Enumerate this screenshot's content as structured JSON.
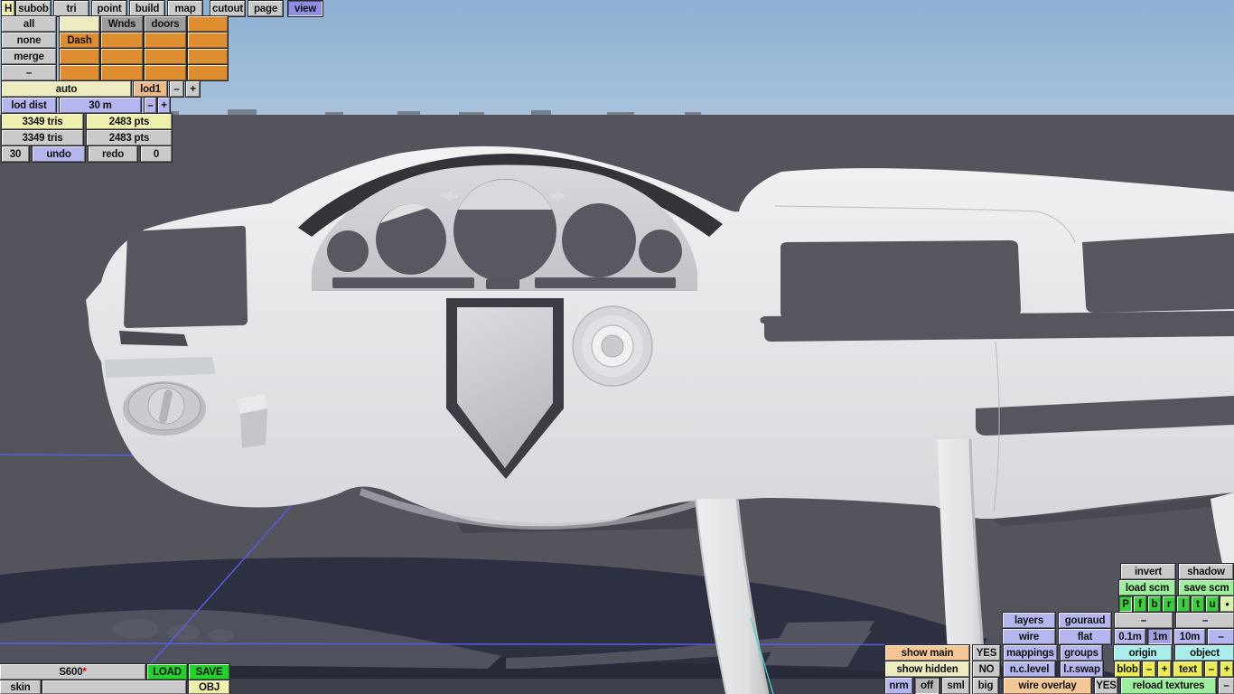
{
  "menu": {
    "items": [
      "H",
      "subob",
      "tri",
      "point",
      "build",
      "map",
      "cutout",
      "page",
      "view"
    ],
    "active": "view"
  },
  "subobject_grid": {
    "row_labels": [
      "all",
      "none",
      "merge",
      "–"
    ],
    "cell_labels": {
      "wnds": "Wnds",
      "doors": "doors",
      "dash": "Dash"
    }
  },
  "lod": {
    "auto_label": "auto",
    "active_lod": "lod1",
    "minus": "–",
    "plus": "+",
    "dist_label": "lod dist",
    "dist_value": "30 m",
    "dist_minus": "–",
    "dist_plus": "+"
  },
  "stats": {
    "selected_tris": "3349 tris",
    "selected_pts": "2483 pts",
    "total_tris": "3349 tris",
    "total_pts": "2483 pts"
  },
  "history": {
    "undo_steps": "30",
    "undo_label": "undo",
    "redo_label": "redo",
    "redo_steps": "0"
  },
  "file": {
    "name": "S600",
    "modified_marker": "*",
    "load_label": "LOAD",
    "save_label": "SAVE",
    "skin_label": "skin",
    "obj_label": "OBJ"
  },
  "render_panel": {
    "invert": "invert",
    "shadow": "shadow",
    "load_scm": "load scm",
    "save_scm": "save scm",
    "view_buttons": [
      "P",
      "f",
      "b",
      "r",
      "l",
      "t",
      "u",
      "●"
    ],
    "layers": "layers",
    "shading_gouraud": "gouraud",
    "dash_a": "–",
    "dash_b": "–",
    "wire": "wire",
    "shading_flat": "flat",
    "grid_small": "0.1m",
    "grid_mid": "1m",
    "grid_big": "10m",
    "dash_c": "–",
    "show_main": "show main",
    "show_main_value": "YES",
    "mappings": "mappings",
    "groups": "groups",
    "origin": "origin",
    "object": "object",
    "show_hidden": "show hidden",
    "show_hidden_value": "NO",
    "nc_level": "n.c.level",
    "lr_swap": "l.r.swap",
    "blob": "blob",
    "blob_minus": "–",
    "blob_plus": "+",
    "text": "text",
    "text_minus": "–",
    "text_plus": "+",
    "nrm": "nrm",
    "nrm_off": "off",
    "nrm_sml": "sml",
    "nrm_big": "big",
    "wire_overlay": "wire overlay",
    "wire_overlay_value": "YES",
    "reload_textures": "reload textures",
    "dash_d": "–"
  },
  "colors": {
    "accent_green": "#22d32a",
    "panel_lavender": "#b5b5ef",
    "cell_orange": "#de8e2e",
    "wire_blue": "#5b5be2",
    "overlay_cyan": "#3fd8cf",
    "sky_blue": "#8fb2d4",
    "wall_grey": "#54545c",
    "car_shadow_navy": "#2c3040"
  }
}
